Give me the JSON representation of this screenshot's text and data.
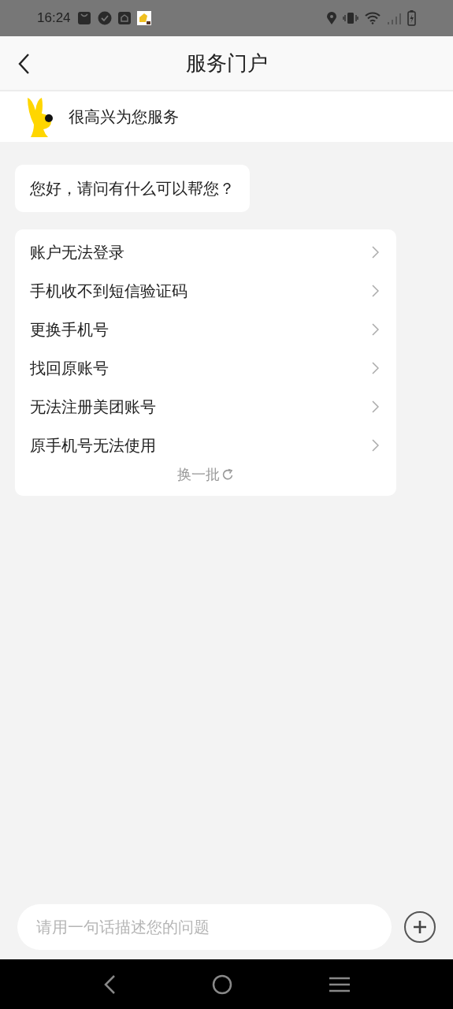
{
  "status_bar": {
    "time": "16:24"
  },
  "header": {
    "title": "服务门户"
  },
  "banner": {
    "text": "很高兴为您服务"
  },
  "greeting": {
    "text": "您好，请问有什么可以帮您？"
  },
  "questions": [
    {
      "label": "账户无法登录"
    },
    {
      "label": "手机收不到短信验证码"
    },
    {
      "label": "更换手机号"
    },
    {
      "label": "找回原账号"
    },
    {
      "label": "无法注册美团账号"
    },
    {
      "label": "原手机号无法使用"
    }
  ],
  "refresh": {
    "label": "换一批"
  },
  "input": {
    "placeholder": "请用一句话描述您的问题"
  }
}
